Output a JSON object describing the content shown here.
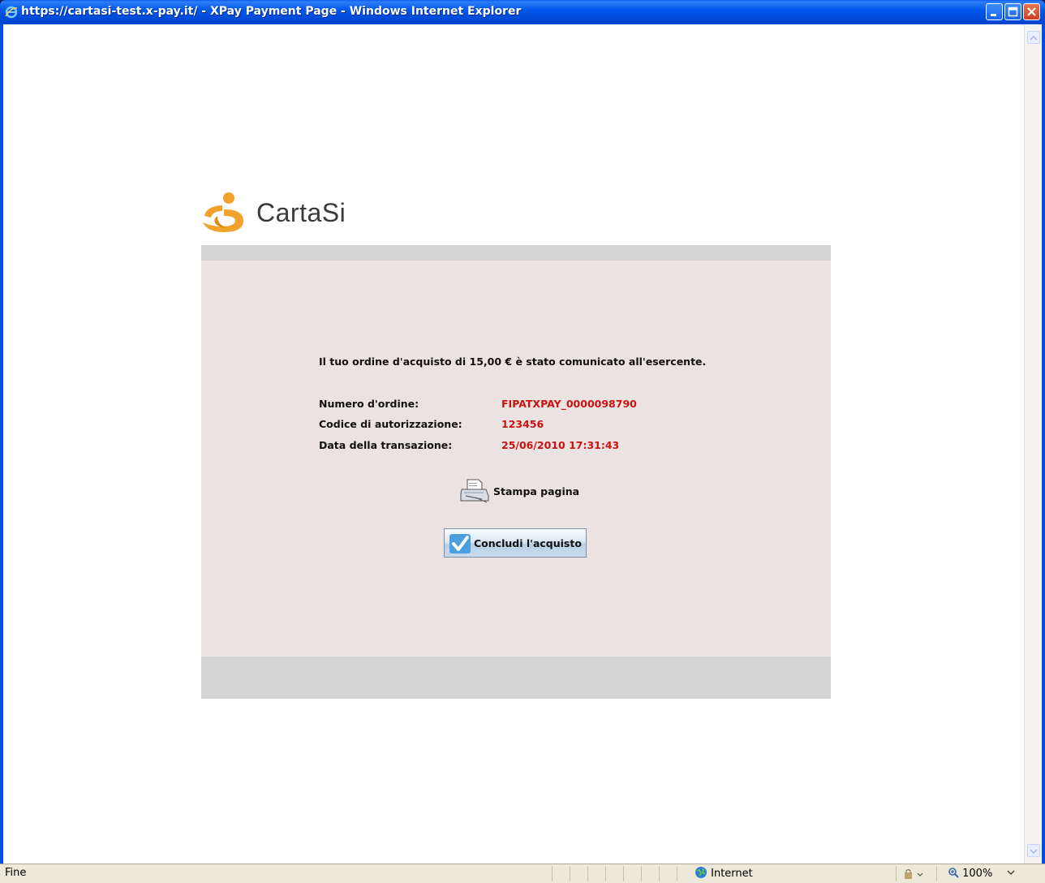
{
  "window": {
    "title": "https://cartasi-test.x-pay.it/ - XPay Payment Page - Windows Internet Explorer"
  },
  "brand": {
    "name": "CartaSi",
    "accent": "#f2a12a"
  },
  "confirmation": {
    "message": "Il tuo ordine d'acquisto di 15,00 € è stato comunicato all'esercente.",
    "details": [
      {
        "label": "Numero d'ordine:",
        "value": "FIPATXPAY_0000098790"
      },
      {
        "label": "Codice di autorizzazione:",
        "value": "123456"
      },
      {
        "label": "Data della transazione:",
        "value": "25/06/2010 17:31:43"
      }
    ],
    "value_color": "#cc1111"
  },
  "actions": {
    "print_label": "Stampa pagina",
    "conclude_label": "Concludi l'acquisto"
  },
  "statusbar": {
    "status": "Fine",
    "zone": "Internet",
    "zoom": "100%"
  }
}
